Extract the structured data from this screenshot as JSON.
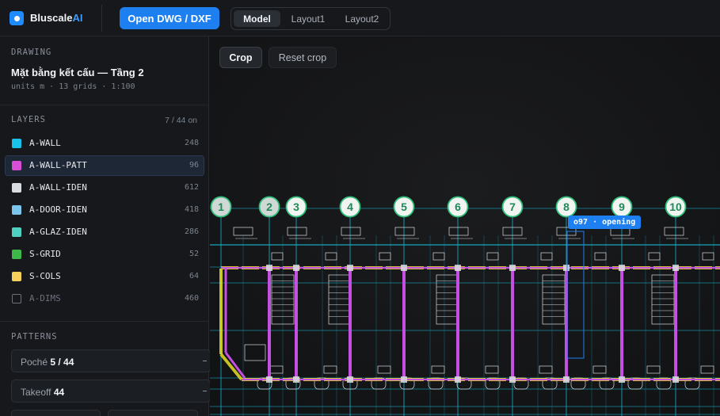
{
  "header": {
    "brand_name": "Bluscale",
    "brand_suffix": "AI",
    "open_button": "Open DWG / DXF",
    "tabs": [
      {
        "label": "Model",
        "active": true
      },
      {
        "label": "Layout1",
        "active": false
      },
      {
        "label": "Layout2",
        "active": false
      }
    ]
  },
  "drawing": {
    "section_title": "DRAWING",
    "name": "Mặt bằng kết cấu — Tầng 2",
    "meta": "units m · 13 grids · 1:100"
  },
  "layers": {
    "section_title": "LAYERS",
    "count_label": "7 / 44 on",
    "items": [
      {
        "name": "A-WALL",
        "count": "248",
        "color": "#19c2e8",
        "on": true
      },
      {
        "name": "A-WALL-PATT",
        "count": "96",
        "color": "#d64fd6",
        "on": true,
        "selected": true
      },
      {
        "name": "A-WALL-IDEN",
        "count": "612",
        "color": "#d9dce0",
        "on": true
      },
      {
        "name": "A-DOOR-IDEN",
        "count": "418",
        "color": "#7cc6ee",
        "on": true
      },
      {
        "name": "A-GLAZ-IDEN",
        "count": "286",
        "color": "#4fd1c2",
        "on": true
      },
      {
        "name": "S-GRID",
        "count": "52",
        "color": "#3fb84a",
        "on": true
      },
      {
        "name": "S-COLS",
        "count": "64",
        "color": "#f5cf5a",
        "on": true
      },
      {
        "name": "A-DIMS",
        "count": "460",
        "color": "#6b7079",
        "on": false
      }
    ]
  },
  "patterns": {
    "section_title": "PATTERNS",
    "poche_label": "Poché",
    "poche_value": "5 / 44",
    "takeoff_label": "Takeoff",
    "takeoff_value": "44"
  },
  "canvas": {
    "crop_button": "Crop",
    "reset_button": "Reset crop",
    "tooltip": "o97 · opening",
    "grid_labels": [
      "1",
      "2",
      "3",
      "4",
      "5",
      "6",
      "7",
      "8",
      "9",
      "10"
    ],
    "colors": {
      "grid_line": "#16b5cf",
      "walls": "#c54fe0",
      "beam": "#e6e024",
      "structure": "#d9dce0",
      "grid_bubble": "#2fbf7a",
      "highlight": "#1e80f0"
    }
  }
}
